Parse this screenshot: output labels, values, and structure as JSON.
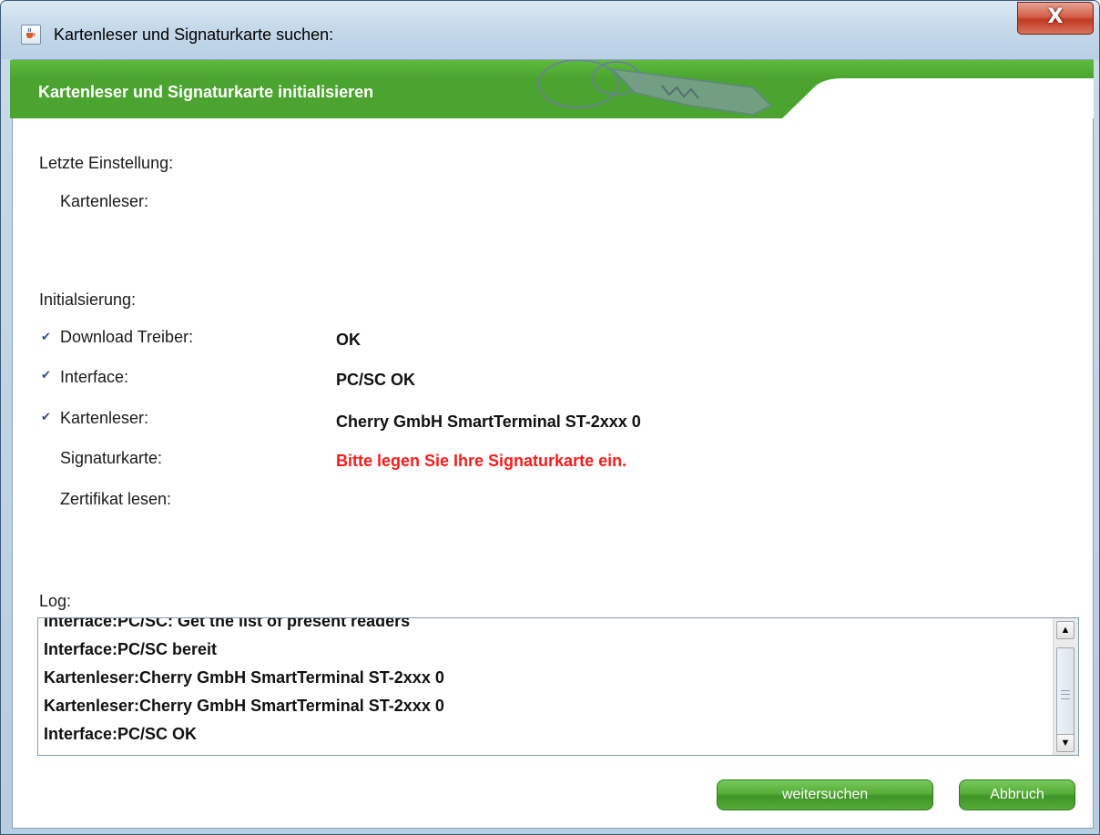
{
  "window": {
    "title": "Kartenleser und Signaturkarte suchen:",
    "close_label": "X"
  },
  "banner": {
    "title": "Kartenleser und Signaturkarte initialisieren"
  },
  "last_setting": {
    "heading": "Letzte Einstellung:",
    "reader_label": "Kartenleser:"
  },
  "init": {
    "heading": "Initialsierung:",
    "rows": [
      {
        "label": "Download Treiber:",
        "value": "OK",
        "checked": true
      },
      {
        "label": "Interface:",
        "value": "PC/SC OK",
        "checked": true
      },
      {
        "label": "Kartenleser:",
        "value": "Cherry GmbH SmartTerminal ST-2xxx 0",
        "checked": true
      },
      {
        "label": "Signaturkarte:",
        "value": "Bitte legen Sie Ihre Signaturkarte ein.",
        "checked": false,
        "status": "error"
      },
      {
        "label": "Zertifikat lesen:",
        "value": "",
        "checked": false
      }
    ]
  },
  "log": {
    "label": "Log:",
    "lines": [
      "Interface:PC/SC: Get the list of present readers",
      "Interface:PC/SC bereit",
      "Kartenleser:Cherry GmbH SmartTerminal ST-2xxx 0",
      "Kartenleser:Cherry GmbH SmartTerminal ST-2xxx 0",
      "Interface:PC/SC OK"
    ]
  },
  "buttons": {
    "search_again": "weitersuchen",
    "cancel": "Abbruch"
  },
  "colors": {
    "banner_green": "#4aa42f",
    "error_red": "#ff1a1a",
    "check_blue": "#2a4a8a"
  },
  "icons": {
    "app": "java-cup-icon",
    "check": "checkmark-icon",
    "keys": "keys-graphic"
  }
}
